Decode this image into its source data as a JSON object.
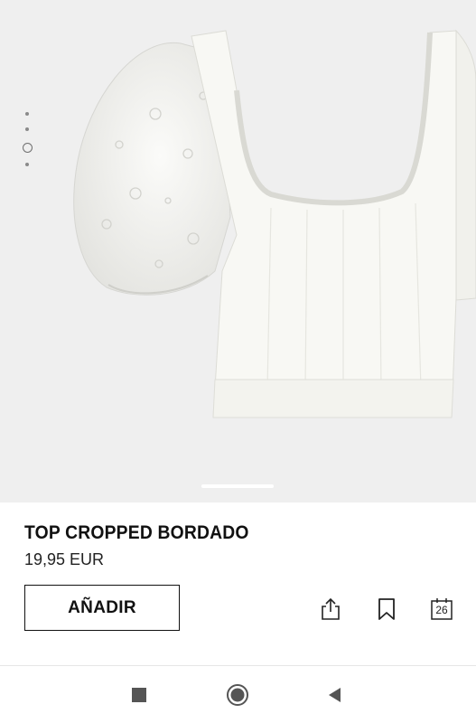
{
  "product": {
    "name": "TOP CROPPED BORDADO",
    "price": "19,95 EUR"
  },
  "actions": {
    "add_label": "AÑADIR",
    "share_icon": "share-icon",
    "bookmark_icon": "bookmark-icon",
    "calendar_icon": "calendar-icon",
    "calendar_number": "26"
  },
  "gallery": {
    "image_count": 4,
    "active_index": 2
  },
  "system_nav": {
    "recents_icon": "square-icon",
    "home_icon": "circle-icon",
    "back_icon": "back-triangle-icon"
  },
  "colors": {
    "hero_background": "#efefef",
    "text": "#111111",
    "accent": "#111111"
  }
}
